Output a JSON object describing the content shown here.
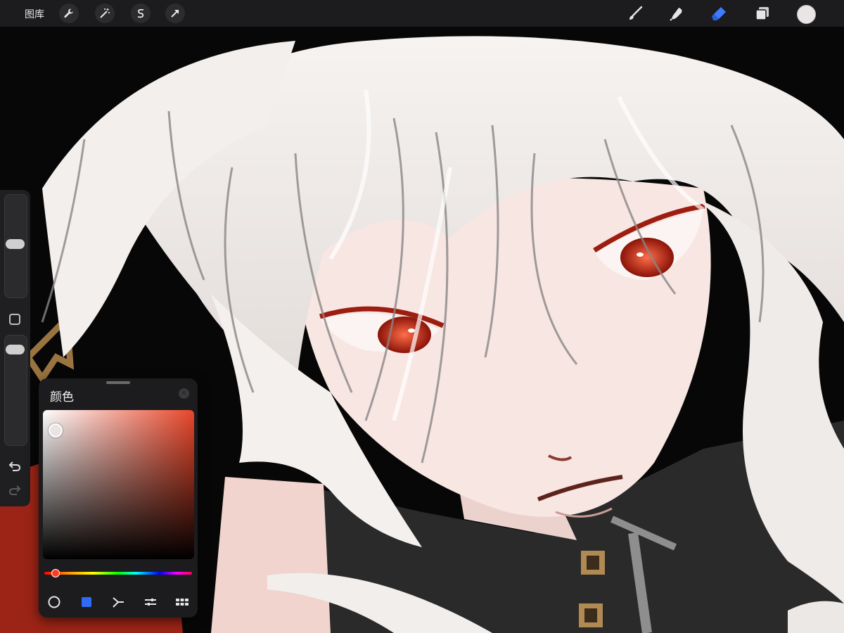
{
  "topbar": {
    "gallery_label": "图库",
    "icons": [
      "wrench-icon",
      "magic-wand-icon",
      "selection-icon",
      "transform-arrow-icon",
      "brush-icon",
      "smudge-icon",
      "eraser-icon",
      "layers-icon"
    ],
    "current_color": "#e9e5e4"
  },
  "sidebar": {
    "brush_size_percent": 50,
    "opacity_percent": 90,
    "tools": [
      "modify-square-icon",
      "undo-icon",
      "redo-icon"
    ]
  },
  "color_panel": {
    "title": "颜色",
    "hue_color": "#e8462a",
    "selected_color": "#e9e5e4",
    "hue_position_percent": 7,
    "tabs": [
      "disc-icon",
      "classic-icon",
      "harmony-icon",
      "value-icon",
      "palettes-icon"
    ],
    "active_tab": "classic-icon",
    "accent": "#2f6bf7"
  },
  "canvas": {
    "artwork": "illustration"
  }
}
